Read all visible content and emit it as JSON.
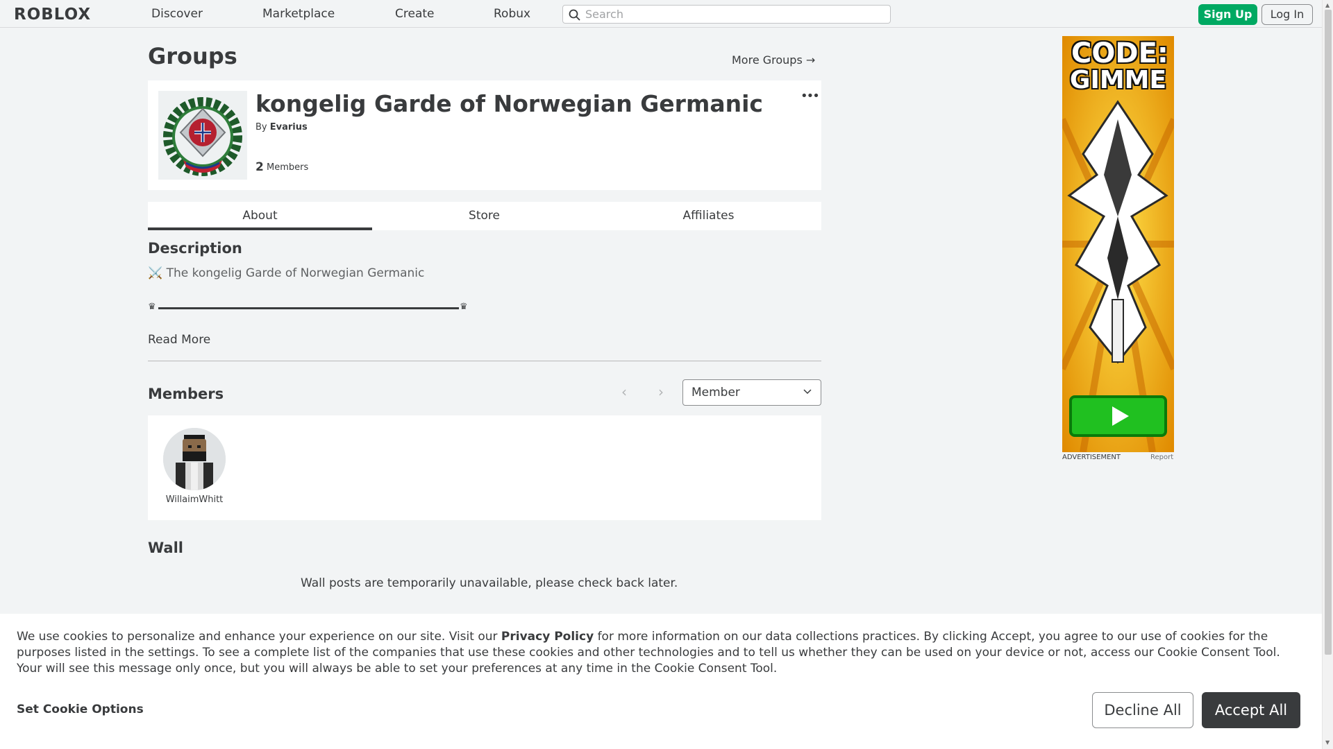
{
  "header": {
    "logo": "ROBLOX",
    "nav": [
      "Discover",
      "Marketplace",
      "Create",
      "Robux"
    ],
    "search_placeholder": "Search",
    "signup_label": "Sign Up",
    "login_label": "Log In"
  },
  "page": {
    "title": "Groups",
    "more_groups": "More Groups →"
  },
  "group": {
    "name": "kongelig Garde of Norwegian Germanic",
    "by_label": "By",
    "owner": "Evarius",
    "member_count": "2",
    "member_count_label": "Members"
  },
  "tabs": [
    "About",
    "Store",
    "Affiliates"
  ],
  "description": {
    "title": "Description",
    "line1": "⚔️ The kongelig Garde of Norwegian Germanic",
    "divider_left": "♛",
    "divider_right": "♛",
    "read_more": "Read More"
  },
  "members": {
    "title": "Members",
    "role_select": "Member",
    "list": [
      {
        "name": "WillaimWhitt"
      }
    ]
  },
  "wall": {
    "title": "Wall",
    "message": "Wall posts are temporarily unavailable, please check back later."
  },
  "ad": {
    "headline_1": "CODE:",
    "headline_2": "GIMME",
    "label": "ADVERTISEMENT",
    "report": "Report"
  },
  "cookie": {
    "text_before": "We use cookies to personalize and enhance your experience on our site. Visit our ",
    "privacy_link": "Privacy Policy",
    "text_after": " for more information on our data collections practices. By clicking Accept, you agree to our use of cookies for the purposes listed in the settings. To see a complete list of the companies that use these cookies and other technologies and to tell us whether they can be used on your device or not, access our Cookie Consent Tool. Your will see this message only once, but you will always be able to set your preferences at any time in the Cookie Consent Tool.",
    "set_options": "Set Cookie Options",
    "decline": "Decline All",
    "accept": "Accept All"
  },
  "colors": {
    "signup_green": "#00a962",
    "accept_dark": "#393b3d",
    "page_bg": "#f2f4f5"
  }
}
